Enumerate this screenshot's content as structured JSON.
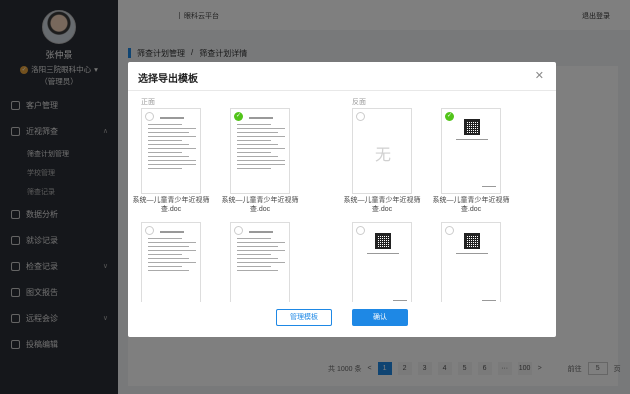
{
  "sidebar": {
    "user_name": "张仲景",
    "org": "洛阳三院眼科中心",
    "role": "（管理员）",
    "items": [
      {
        "label": "客户管理"
      },
      {
        "label": "近视筛查"
      },
      {
        "label": "筛查计划管理"
      },
      {
        "label": "学校管理"
      },
      {
        "label": "筛查记录"
      },
      {
        "label": "数据分析"
      },
      {
        "label": "就诊记录"
      },
      {
        "label": "检查记录"
      },
      {
        "label": "图文报告"
      },
      {
        "label": "远程会诊"
      },
      {
        "label": "投稿编辑"
      }
    ]
  },
  "header": {
    "site": "眼科云平台",
    "logout": "退出登录"
  },
  "breadcrumb": {
    "level1": "筛查计划管理",
    "sep": "/",
    "level2": "筛查计划详情"
  },
  "pager": {
    "total": "共 1000 条",
    "prev": "<",
    "pages": [
      "1",
      "2",
      "3",
      "4",
      "5",
      "6",
      "···",
      "100"
    ],
    "next": ">",
    "goto": "前往",
    "goto_value": "5",
    "page_unit": "页"
  },
  "modal": {
    "title": "选择导出模板",
    "close": "✕",
    "front_label": "正面",
    "back_label": "反面",
    "empty_char": "无",
    "template_name": "系统—儿童青少年近视筛查.doc",
    "manage_button": "管理模板",
    "confirm_button": "确认",
    "selected": {
      "front": 2,
      "back": 2
    }
  }
}
